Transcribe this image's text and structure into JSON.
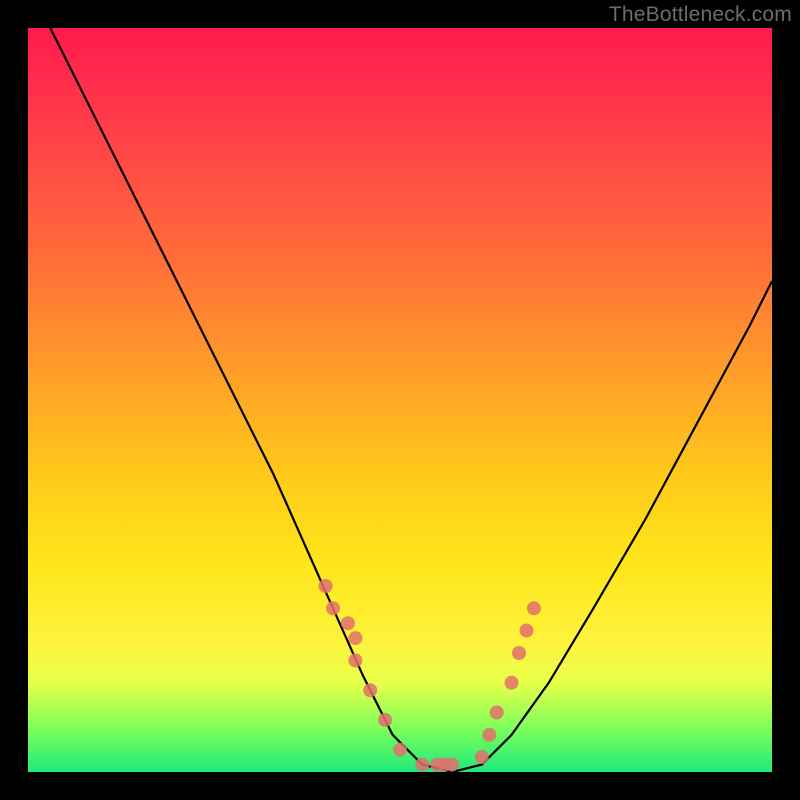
{
  "watermark": "TheBottleneck.com",
  "chart_data": {
    "type": "line",
    "title": "",
    "xlabel": "",
    "ylabel": "",
    "xlim": [
      0,
      1
    ],
    "ylim": [
      0,
      1
    ],
    "series": [
      {
        "name": "bottleneck-curve",
        "x": [
          0.03,
          0.08,
          0.13,
          0.18,
          0.23,
          0.28,
          0.33,
          0.37,
          0.41,
          0.45,
          0.49,
          0.53,
          0.57,
          0.61,
          0.65,
          0.7,
          0.76,
          0.83,
          0.9,
          0.97,
          1.0
        ],
        "y": [
          1.0,
          0.9,
          0.8,
          0.7,
          0.6,
          0.5,
          0.4,
          0.31,
          0.22,
          0.13,
          0.05,
          0.01,
          0.0,
          0.01,
          0.05,
          0.12,
          0.22,
          0.34,
          0.47,
          0.6,
          0.66
        ]
      },
      {
        "name": "left-cluster-dots",
        "x": [
          0.4,
          0.41,
          0.43,
          0.44,
          0.44,
          0.46,
          0.48,
          0.5,
          0.53,
          0.55,
          0.56,
          0.57
        ],
        "y": [
          0.25,
          0.22,
          0.2,
          0.18,
          0.15,
          0.11,
          0.07,
          0.03,
          0.01,
          0.01,
          0.01,
          0.01
        ]
      },
      {
        "name": "right-cluster-dots",
        "x": [
          0.61,
          0.62,
          0.63,
          0.65,
          0.66,
          0.67,
          0.68
        ],
        "y": [
          0.02,
          0.05,
          0.08,
          0.12,
          0.16,
          0.19,
          0.22
        ]
      }
    ],
    "colors": {
      "curve": "#000000",
      "dots": "#e2706c"
    }
  }
}
